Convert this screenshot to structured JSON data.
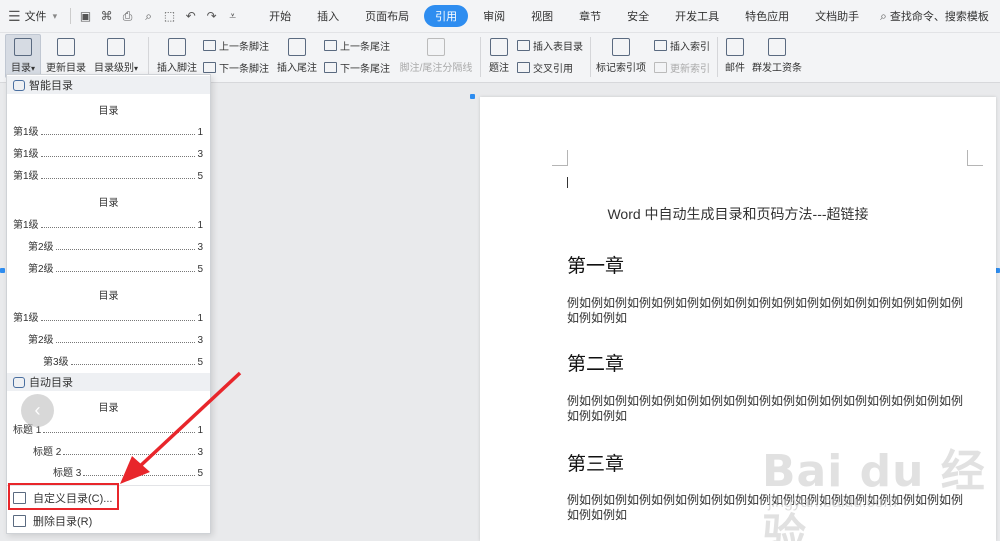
{
  "menubar": {
    "file_label": "文件",
    "tabs": [
      "开始",
      "插入",
      "页面布局",
      "引用",
      "审阅",
      "视图",
      "章节",
      "安全",
      "开发工具",
      "特色应用",
      "文档助手"
    ],
    "active_tab": "引用",
    "search_label": "查找命令、搜索模板"
  },
  "ribbon": {
    "toc": "目录",
    "update_toc": "更新目录",
    "toc_level": "目录级别",
    "insert_footnote": "插入脚注",
    "prev_footnote": "上一条脚注",
    "next_footnote": "下一条脚注",
    "insert_endnote": "插入尾注",
    "prev_endnote": "上一条尾注",
    "next_endnote": "下一条尾注",
    "note_separator": "脚注/尾注分隔线",
    "caption": "题注",
    "insert_table_of_figures": "插入表目录",
    "cross_reference": "交叉引用",
    "mark_index_entry": "标记索引项",
    "insert_index": "插入索引",
    "update_index": "更新索引",
    "mail": "邮件",
    "mass_payroll": "群发工资条"
  },
  "panel": {
    "smart_toc_header": "智能目录",
    "auto_toc_header": "自动目录",
    "toc_word": "目录",
    "preview1": [
      {
        "label": "第1级",
        "page": "1"
      },
      {
        "label": "第1级",
        "page": "3"
      },
      {
        "label": "第1级",
        "page": "5"
      }
    ],
    "preview2": [
      {
        "label": "第1级",
        "page": "1"
      },
      {
        "label": "第2级",
        "page": "3"
      },
      {
        "label": "第2级",
        "page": "5"
      }
    ],
    "preview3": [
      {
        "label": "第1级",
        "page": "1"
      },
      {
        "label": "第2级",
        "page": "3"
      },
      {
        "label": "第3级",
        "page": "5"
      }
    ],
    "auto_preview": [
      {
        "label": "标题 1",
        "page": "1"
      },
      {
        "label": "标题 2",
        "page": "3"
      },
      {
        "label": "标题 3",
        "page": "5"
      }
    ],
    "custom_toc": "自定义目录(C)...",
    "delete_toc": "删除目录(R)"
  },
  "document": {
    "title": "Word 中自动生成目录和页码方法---超链接",
    "chapters": [
      {
        "heading": "第一章",
        "body": "例如例如例如例如例如例如例如例如例如例如例如例如例如例如例如例如例如例如例如"
      },
      {
        "heading": "第二章",
        "body": "例如例如例如例如例如例如例如例如例如例如例如例如例如例如例如例如例如例如例如"
      },
      {
        "heading": "第三章",
        "body": "例如例如例如例如例如例如例如例如例如例如例如例如例如例如例如例如例如例如例如"
      }
    ]
  },
  "watermark": {
    "brand": "Bai du 经验",
    "url": "jingyan.baidu.com"
  },
  "colors": {
    "accent": "#2e8df0",
    "highlight": "#e8262b"
  }
}
